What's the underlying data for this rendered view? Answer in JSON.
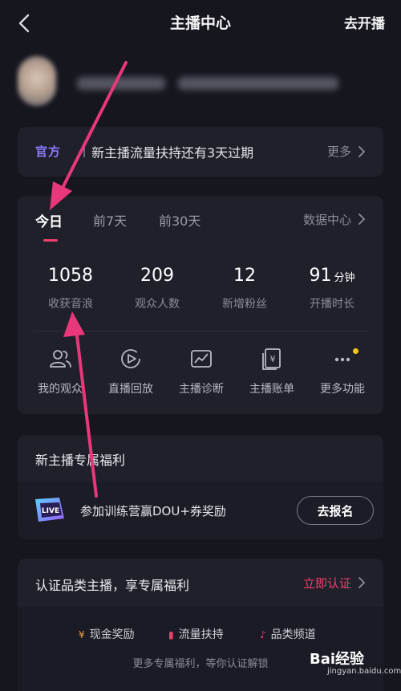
{
  "header": {
    "title": "主播中心",
    "go_live": "去开播"
  },
  "notice": {
    "badge": "官方",
    "message": "新主播流量扶持还有3天过期",
    "more": "更多"
  },
  "stats_card": {
    "tabs": [
      "今日",
      "前7天",
      "前30天"
    ],
    "data_center": "数据中心",
    "stats": [
      {
        "value": "1058",
        "unit": "",
        "label": "收获音浪"
      },
      {
        "value": "209",
        "unit": "",
        "label": "观众人数"
      },
      {
        "value": "12",
        "unit": "",
        "label": "新增粉丝"
      },
      {
        "value": "91",
        "unit": "分钟",
        "label": "开播时长"
      }
    ],
    "functions": [
      {
        "label": "我的观众",
        "icon": "audience-icon"
      },
      {
        "label": "直播回放",
        "icon": "replay-icon"
      },
      {
        "label": "主播诊断",
        "icon": "diagnosis-icon"
      },
      {
        "label": "主播账单",
        "icon": "bill-icon"
      },
      {
        "label": "更多功能",
        "icon": "more-icon"
      }
    ]
  },
  "benefit": {
    "heading": "新主播专属福利",
    "item_text": "参加训练营赢DOU+券奖励",
    "signup": "去报名",
    "logo_text": "LIVE"
  },
  "certify": {
    "heading": "认证品类主播，享专属福利",
    "action": "立即认证",
    "perks": [
      {
        "icon": "¥",
        "label": "现金奖励"
      },
      {
        "icon": "▮",
        "label": "流量扶持"
      },
      {
        "icon": "♪",
        "label": "品类频道"
      }
    ],
    "sub": "更多专属福利，等你认证解锁"
  },
  "watermark": {
    "logo_text": "Bai经验",
    "url": "jingyan.baidu.com"
  },
  "colors": {
    "background": "#16161f",
    "card": "#20202b",
    "accent": "#f0406e",
    "official_badge": "#8a7cff",
    "arrow": "#e8377a",
    "dot": "#f5c518"
  }
}
